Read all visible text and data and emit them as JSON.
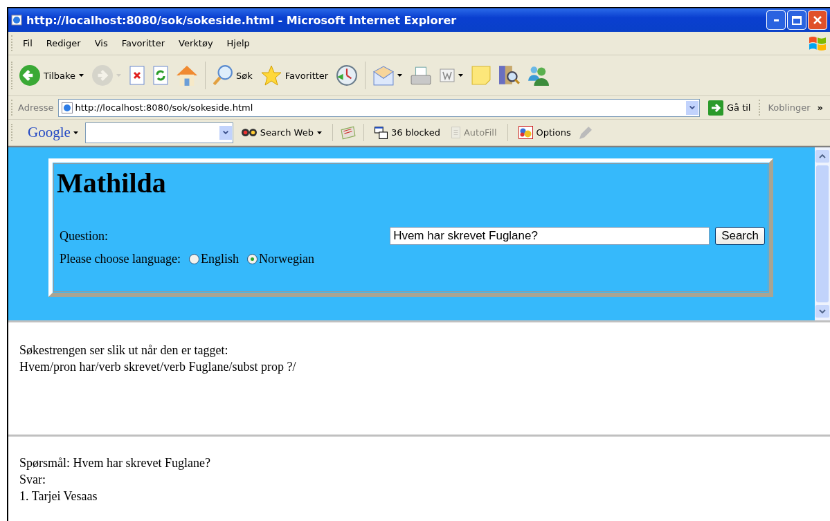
{
  "window": {
    "title": "http://localhost:8080/sok/sokeside.html - Microsoft Internet Explorer"
  },
  "menu": [
    "Fil",
    "Rediger",
    "Vis",
    "Favoritter",
    "Verktøy",
    "Hjelp"
  ],
  "toolbar": [
    {
      "kind": "back",
      "label": "Tilbake",
      "dropdown": true,
      "disabled": false
    },
    {
      "kind": "forward",
      "dropdown": true,
      "disabled": true
    },
    {
      "kind": "stop",
      "disabled": false
    },
    {
      "kind": "refresh",
      "disabled": false
    },
    {
      "kind": "home",
      "disabled": false
    },
    {
      "kind": "search",
      "label": "Søk",
      "disabled": false
    },
    {
      "kind": "favorites",
      "label": "Favoritter",
      "disabled": false
    },
    {
      "kind": "history",
      "disabled": false
    },
    {
      "kind": "mail",
      "dropdown": true,
      "disabled": false
    },
    {
      "kind": "print",
      "disabled": false
    },
    {
      "kind": "word",
      "dropdown": true,
      "disabled": false
    },
    {
      "kind": "note",
      "disabled": false
    },
    {
      "kind": "research",
      "disabled": false
    },
    {
      "kind": "messenger",
      "disabled": false
    }
  ],
  "address_bar": {
    "label": "Adresse",
    "url": "http://localhost:8080/sok/sokeside.html",
    "go": "Gå til",
    "links": "Koblinger",
    "more": "»"
  },
  "google_bar": {
    "logo": "Google",
    "search_web": "Search Web",
    "blocked": "36 blocked",
    "autofill": "AutoFill",
    "autofill_disabled": true,
    "options": "Options"
  },
  "form": {
    "heading": "Mathilda",
    "question_label": "Question:",
    "question_value": "Hvem har skrevet Fuglane?",
    "search_button": "Search",
    "language_label": "Please choose language:",
    "languages": [
      {
        "label": "English",
        "selected": false
      },
      {
        "label": "Norwegian",
        "selected": true
      }
    ]
  },
  "tagged": {
    "lines": [
      "Søkestrengen ser slik ut når den er tagget:",
      "Hvem/pron har/verb skrevet/verb Fuglane/subst prop ?/"
    ]
  },
  "answer": {
    "lines": [
      "Spørsmål: Hvem har skrevet Fuglane?",
      "Svar:",
      "1. Tarjei Vesaas"
    ]
  }
}
